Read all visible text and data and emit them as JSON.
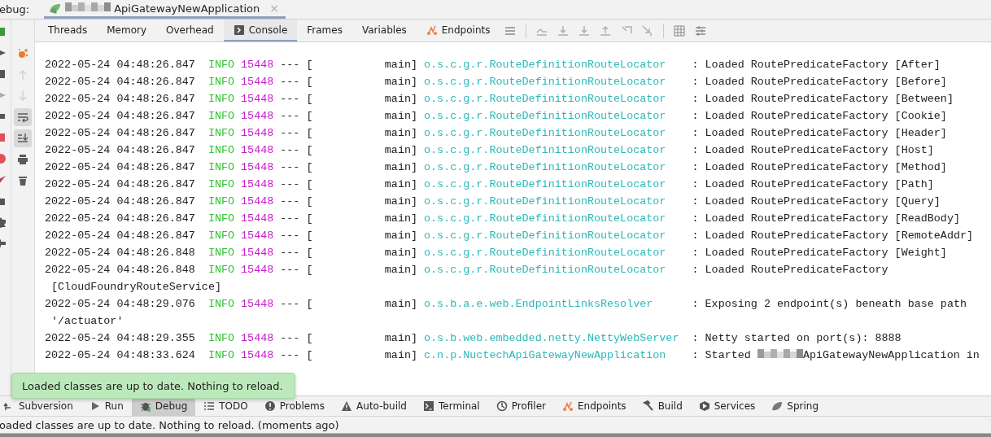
{
  "debug_bar": {
    "label": "ebug:",
    "session_tab": {
      "title": "ApiGatewayNewApplication",
      "selected": true,
      "close": "×"
    }
  },
  "tabs": [
    {
      "label": "Threads",
      "selected": false
    },
    {
      "label": "Memory",
      "selected": false
    },
    {
      "label": "Overhead",
      "selected": false
    },
    {
      "label": "Console",
      "selected": true
    },
    {
      "label": "Frames",
      "selected": false
    },
    {
      "label": "Variables",
      "selected": false
    },
    {
      "label": "Endpoints",
      "selected": false
    }
  ],
  "gutter_buttons": [
    {
      "on": false,
      "disabled": false
    },
    {
      "on": false,
      "disabled": true
    },
    {
      "on": false,
      "disabled": true
    },
    {
      "on": true,
      "disabled": false
    },
    {
      "on": true,
      "disabled": false
    },
    {
      "on": false,
      "disabled": false
    },
    {
      "on": false,
      "disabled": false
    }
  ],
  "console": {
    "lines": [
      {
        "time": "2022-05-24 04:48:26.847",
        "level": "INFO",
        "pid": "15448",
        "thread": "--- [           main]",
        "logger": "o.s.c.g.r.RouteDefinitionRouteLocator",
        "message": ": Loaded RoutePredicateFactory [After]"
      },
      {
        "time": "2022-05-24 04:48:26.847",
        "level": "INFO",
        "pid": "15448",
        "thread": "--- [           main]",
        "logger": "o.s.c.g.r.RouteDefinitionRouteLocator",
        "message": ": Loaded RoutePredicateFactory [Before]"
      },
      {
        "time": "2022-05-24 04:48:26.847",
        "level": "INFO",
        "pid": "15448",
        "thread": "--- [           main]",
        "logger": "o.s.c.g.r.RouteDefinitionRouteLocator",
        "message": ": Loaded RoutePredicateFactory [Between]"
      },
      {
        "time": "2022-05-24 04:48:26.847",
        "level": "INFO",
        "pid": "15448",
        "thread": "--- [           main]",
        "logger": "o.s.c.g.r.RouteDefinitionRouteLocator",
        "message": ": Loaded RoutePredicateFactory [Cookie]"
      },
      {
        "time": "2022-05-24 04:48:26.847",
        "level": "INFO",
        "pid": "15448",
        "thread": "--- [           main]",
        "logger": "o.s.c.g.r.RouteDefinitionRouteLocator",
        "message": ": Loaded RoutePredicateFactory [Header]"
      },
      {
        "time": "2022-05-24 04:48:26.847",
        "level": "INFO",
        "pid": "15448",
        "thread": "--- [           main]",
        "logger": "o.s.c.g.r.RouteDefinitionRouteLocator",
        "message": ": Loaded RoutePredicateFactory [Host]"
      },
      {
        "time": "2022-05-24 04:48:26.847",
        "level": "INFO",
        "pid": "15448",
        "thread": "--- [           main]",
        "logger": "o.s.c.g.r.RouteDefinitionRouteLocator",
        "message": ": Loaded RoutePredicateFactory [Method]"
      },
      {
        "time": "2022-05-24 04:48:26.847",
        "level": "INFO",
        "pid": "15448",
        "thread": "--- [           main]",
        "logger": "o.s.c.g.r.RouteDefinitionRouteLocator",
        "message": ": Loaded RoutePredicateFactory [Path]"
      },
      {
        "time": "2022-05-24 04:48:26.847",
        "level": "INFO",
        "pid": "15448",
        "thread": "--- [           main]",
        "logger": "o.s.c.g.r.RouteDefinitionRouteLocator",
        "message": ": Loaded RoutePredicateFactory [Query]"
      },
      {
        "time": "2022-05-24 04:48:26.847",
        "level": "INFO",
        "pid": "15448",
        "thread": "--- [           main]",
        "logger": "o.s.c.g.r.RouteDefinitionRouteLocator",
        "message": ": Loaded RoutePredicateFactory [ReadBody]"
      },
      {
        "time": "2022-05-24 04:48:26.847",
        "level": "INFO",
        "pid": "15448",
        "thread": "--- [           main]",
        "logger": "o.s.c.g.r.RouteDefinitionRouteLocator",
        "message": ": Loaded RoutePredicateFactory [RemoteAddr]"
      },
      {
        "time": "2022-05-24 04:48:26.848",
        "level": "INFO",
        "pid": "15448",
        "thread": "--- [           main]",
        "logger": "o.s.c.g.r.RouteDefinitionRouteLocator",
        "message": ": Loaded RoutePredicateFactory [Weight]"
      },
      {
        "time": "2022-05-24 04:48:26.848",
        "level": "INFO",
        "pid": "15448",
        "thread": "--- [           main]",
        "logger": "o.s.c.g.r.RouteDefinitionRouteLocator",
        "message": ": Loaded RoutePredicateFactory",
        "continuation": "[CloudFoundryRouteService]"
      },
      {
        "time": "2022-05-24 04:48:29.076",
        "level": "INFO",
        "pid": "15448",
        "thread": "--- [           main]",
        "logger": "o.s.b.a.e.web.EndpointLinksResolver",
        "message": ": Exposing 2 endpoint(s) beneath base path",
        "continuation": "'/actuator'"
      },
      {
        "time": "2022-05-24 04:48:29.355",
        "level": "INFO",
        "pid": "15448",
        "thread": "--- [           main]",
        "logger": "o.s.b.web.embedded.netty.NettyWebServer",
        "message": ": Netty started on port(s): 8888"
      },
      {
        "time": "2022-05-24 04:48:33.624",
        "level": "INFO",
        "pid": "15448",
        "thread": "--- [           main]",
        "logger": "c.n.p.NuctechApiGatewayNewApplication",
        "message": ": Started",
        "message_after": "ApiGatewayNewApplication in"
      }
    ]
  },
  "tooltip": {
    "text": "Loaded classes are up to date. Nothing to reload."
  },
  "tool_windows": [
    {
      "label": "Subversion",
      "selected": false
    },
    {
      "label": "Run",
      "selected": false
    },
    {
      "label": "Debug",
      "selected": true
    },
    {
      "label": "TODO",
      "selected": false
    },
    {
      "label": "Problems",
      "selected": false
    },
    {
      "label": "Auto-build",
      "selected": false
    },
    {
      "label": "Terminal",
      "selected": false
    },
    {
      "label": "Profiler",
      "selected": false
    },
    {
      "label": "Endpoints",
      "selected": false
    },
    {
      "label": "Build",
      "selected": false
    },
    {
      "label": "Services",
      "selected": false
    },
    {
      "label": "Spring",
      "selected": false
    }
  ],
  "status_bar": {
    "text": "oaded classes are up to date. Nothing to reload. (moments ago)"
  }
}
